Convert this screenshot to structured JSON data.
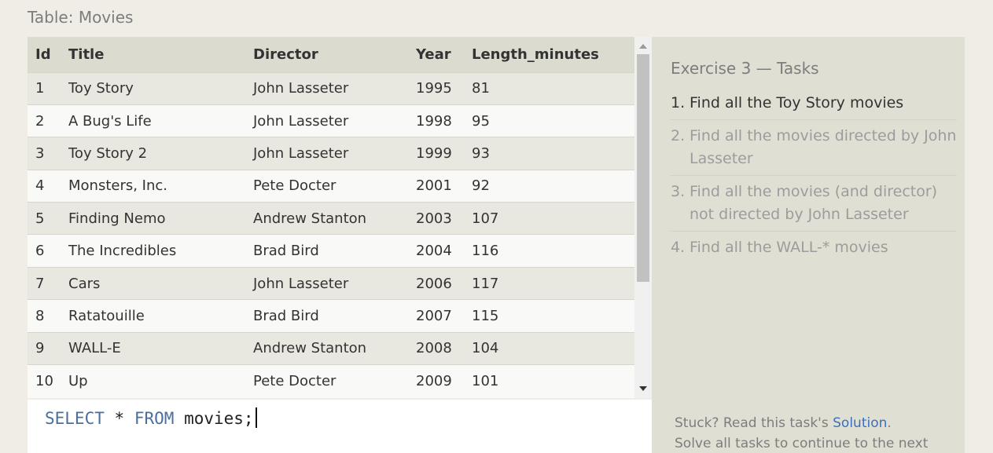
{
  "table_label": "Table: Movies",
  "columns": [
    "Id",
    "Title",
    "Director",
    "Year",
    "Length_minutes"
  ],
  "rows": [
    [
      "1",
      "Toy Story",
      "John Lasseter",
      "1995",
      "81"
    ],
    [
      "2",
      "A Bug's Life",
      "John Lasseter",
      "1998",
      "95"
    ],
    [
      "3",
      "Toy Story 2",
      "John Lasseter",
      "1999",
      "93"
    ],
    [
      "4",
      "Monsters, Inc.",
      "Pete Docter",
      "2001",
      "92"
    ],
    [
      "5",
      "Finding Nemo",
      "Andrew Stanton",
      "2003",
      "107"
    ],
    [
      "6",
      "The Incredibles",
      "Brad Bird",
      "2004",
      "116"
    ],
    [
      "7",
      "Cars",
      "John Lasseter",
      "2006",
      "117"
    ],
    [
      "8",
      "Ratatouille",
      "Brad Bird",
      "2007",
      "115"
    ],
    [
      "9",
      "WALL-E",
      "Andrew Stanton",
      "2008",
      "104"
    ],
    [
      "10",
      "Up",
      "Pete Docter",
      "2009",
      "101"
    ]
  ],
  "editor": {
    "select_kw": "SELECT",
    "star": "*",
    "from_kw": "FROM",
    "table": "movies;"
  },
  "tasks": {
    "title": "Exercise 3 — Tasks",
    "items": [
      {
        "num": "1.",
        "text": "Find all the Toy Story movies",
        "active": true
      },
      {
        "num": "2.",
        "text": "Find all the movies directed by John Lasseter",
        "active": false
      },
      {
        "num": "3.",
        "text": "Find all the movies (and director) not directed by John Lasseter",
        "active": false
      },
      {
        "num": "4.",
        "text": "Find all the WALL-* movies",
        "active": false
      }
    ]
  },
  "footer": {
    "stuck_text": "Stuck? Read this task's ",
    "solution_link": "Solution",
    "period": ".",
    "continue_text": "Solve all tasks to continue to the next"
  },
  "colors": {
    "keyword": "#4b6e9c",
    "link": "#3b6fc1",
    "header_bg": "#dcdbd0",
    "tasks_bg": "#e0dfd4"
  }
}
